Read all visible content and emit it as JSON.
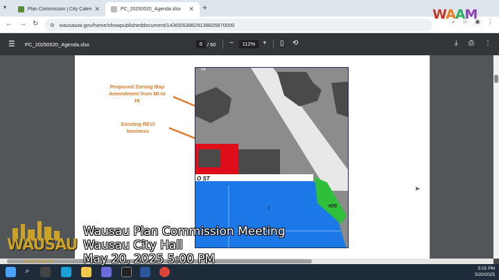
{
  "browser": {
    "tabs": [
      {
        "title": "Plan Commission | City Calenda",
        "active": false
      },
      {
        "title": "PC_20250520_Agenda.xlsx",
        "active": true
      }
    ],
    "url": "wausauwi.gov/home/showpublisheddocument/14365/638829138835870000"
  },
  "pdf": {
    "filename": "PC_20250520_Agenda.xlsx",
    "page_current": "6",
    "page_total": "/ 60",
    "zoom": "112%"
  },
  "map": {
    "callouts": [
      "Proposed Zoning Map Amendment from MI to HI",
      "Existing REVI business"
    ],
    "labels": {
      "zone_top_left": "MI",
      "street": "O ST",
      "zone_ios": "IOS",
      "zone_blue": "I"
    },
    "colors": {
      "industrial_gray": "#8c8c8c",
      "dark_buildings": "#4a4a4a",
      "red_parcel": "#e00d1b",
      "blue_zone": "#1b78e6",
      "green_zone": "#2fbf3a",
      "arrow_orange": "#e07b2a"
    }
  },
  "overlay": {
    "line1": "Wausau Plan Commission Meeting",
    "line2": "Wausau City Hall",
    "line3": "May 20, 2025 5:00 PM",
    "logo_word": "WAUSAU",
    "logo_sub": "WISCONSIN"
  },
  "watermark": "WAAM",
  "taskbar": {
    "time": "5:01 PM",
    "date": "5/20/2025"
  }
}
